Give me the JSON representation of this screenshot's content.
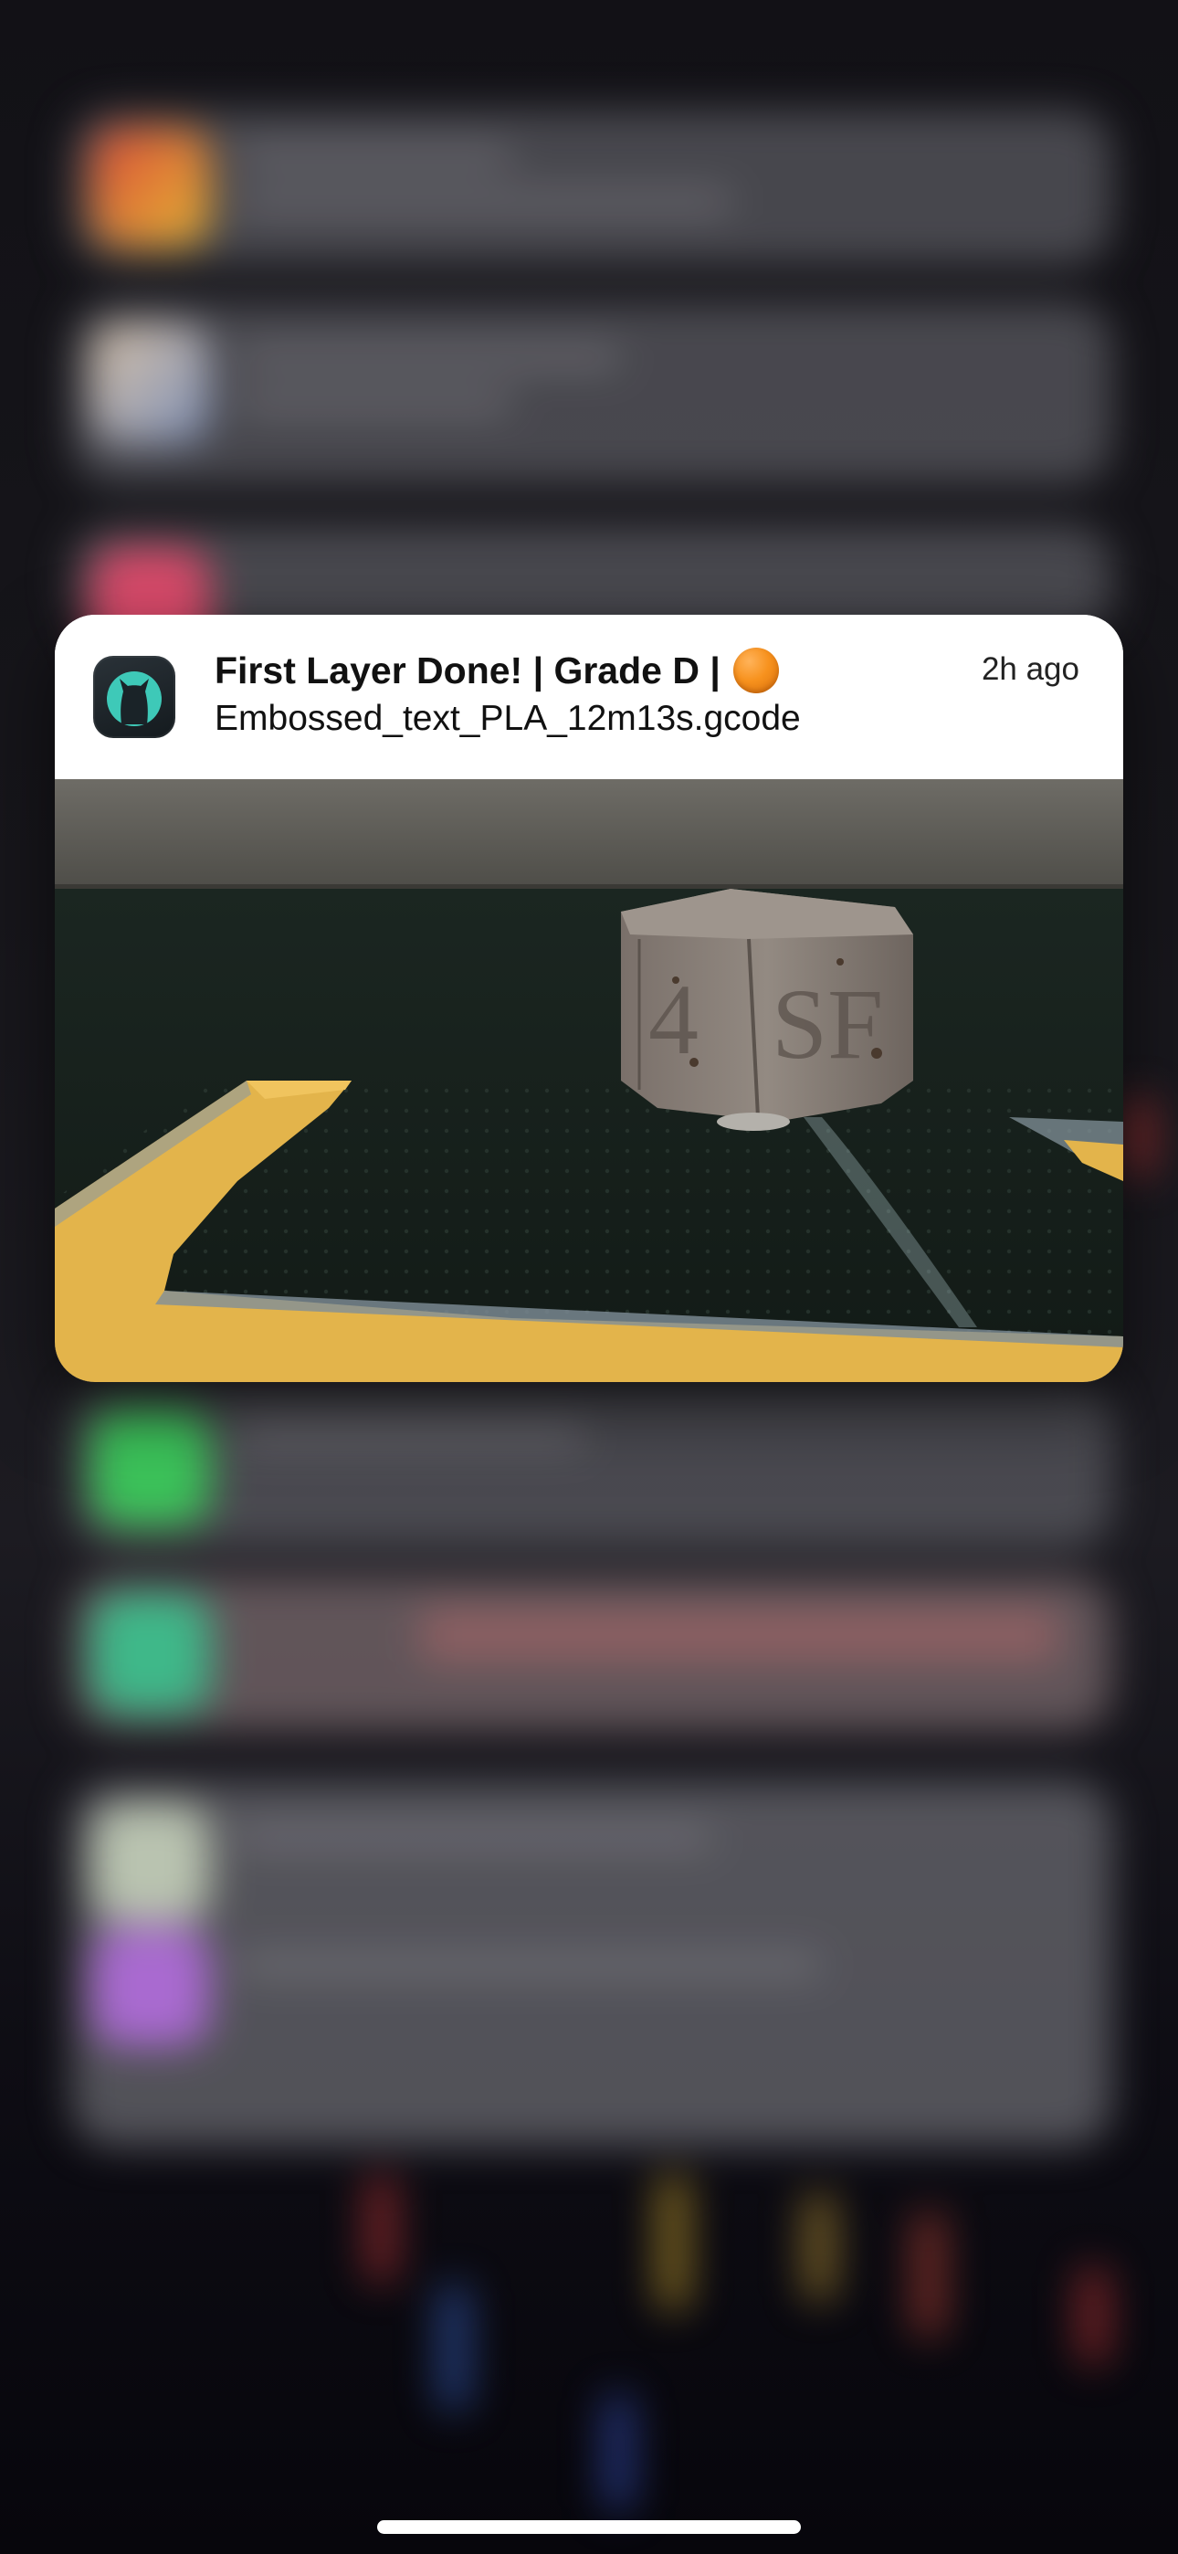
{
  "notification": {
    "app_icon": "cat-icon",
    "title": "First Layer Done! | Grade D |",
    "status_indicator": "orange-circle-icon",
    "subtitle": "Embossed_text_PLA_12m13s.gcode",
    "time": "2h ago",
    "image": {
      "emboss_text_left": "4",
      "emboss_text_right": "SF"
    }
  },
  "colors": {
    "app_icon_accent": "#3ec9b8",
    "status_orange": "#f7921e",
    "print_filament": "#e3b44b"
  }
}
